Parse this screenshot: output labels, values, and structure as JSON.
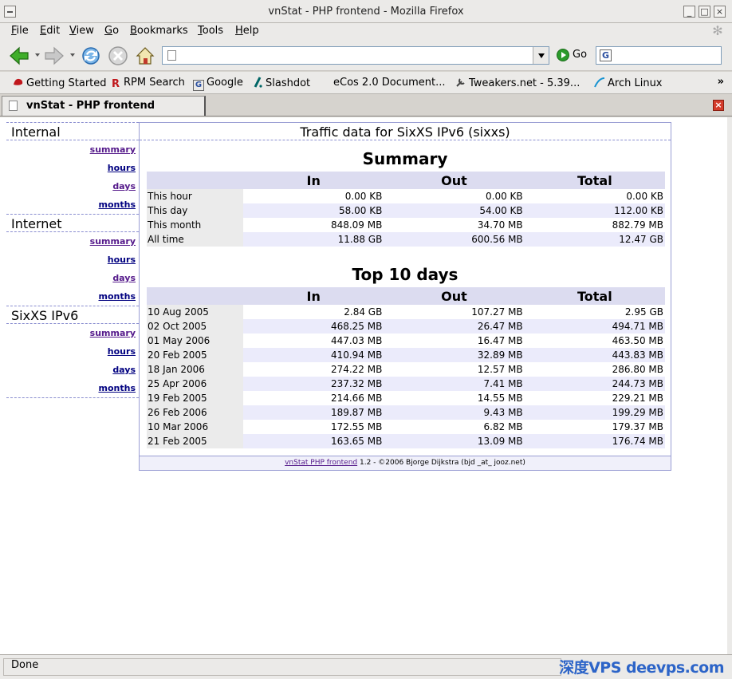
{
  "window": {
    "title": "vnStat - PHP frontend - Mozilla Firefox"
  },
  "menu": [
    "File",
    "Edit",
    "View",
    "Go",
    "Bookmarks",
    "Tools",
    "Help"
  ],
  "toolbar": {
    "go_label": "Go",
    "url_value": "",
    "search_value": ""
  },
  "bookmarks": [
    {
      "label": "Getting Started",
      "icon": "redhat-icon"
    },
    {
      "label": "RPM Search",
      "icon": "rpm-icon"
    },
    {
      "label": "Google",
      "icon": "google-icon"
    },
    {
      "label": "Slashdot",
      "icon": "slashdot-icon"
    },
    {
      "label": "eCos 2.0 Document...",
      "icon": ""
    },
    {
      "label": "Tweakers.net - 5.39...",
      "icon": "tweakers-icon"
    },
    {
      "label": "Arch Linux",
      "icon": "arch-icon"
    }
  ],
  "tab": {
    "title": "vnStat - PHP frontend"
  },
  "sidebar": [
    {
      "heading": "Internal",
      "links": [
        "summary",
        "hours",
        "days",
        "months"
      ]
    },
    {
      "heading": "Internet",
      "links": [
        "summary",
        "hours",
        "days",
        "months"
      ]
    },
    {
      "heading": "SixXS IPv6",
      "links": [
        "summary",
        "hours",
        "days",
        "months"
      ]
    }
  ],
  "main": {
    "title": "Traffic data for SixXS IPv6 (sixxs)",
    "summary": {
      "heading": "Summary",
      "columns": [
        "In",
        "Out",
        "Total"
      ],
      "rows": [
        {
          "label": "This hour",
          "in": "0.00 KB",
          "out": "0.00 KB",
          "total": "0.00 KB"
        },
        {
          "label": "This day",
          "in": "58.00 KB",
          "out": "54.00 KB",
          "total": "112.00 KB"
        },
        {
          "label": "This month",
          "in": "848.09 MB",
          "out": "34.70 MB",
          "total": "882.79 MB"
        },
        {
          "label": "All time",
          "in": "11.88 GB",
          "out": "600.56 MB",
          "total": "12.47 GB"
        }
      ]
    },
    "top10": {
      "heading": "Top 10 days",
      "columns": [
        "In",
        "Out",
        "Total"
      ],
      "rows": [
        {
          "label": "10 Aug 2005",
          "in": "2.84 GB",
          "out": "107.27 MB",
          "total": "2.95 GB"
        },
        {
          "label": "02 Oct 2005",
          "in": "468.25 MB",
          "out": "26.47 MB",
          "total": "494.71 MB"
        },
        {
          "label": "01 May 2006",
          "in": "447.03 MB",
          "out": "16.47 MB",
          "total": "463.50 MB"
        },
        {
          "label": "20 Feb 2005",
          "in": "410.94 MB",
          "out": "32.89 MB",
          "total": "443.83 MB"
        },
        {
          "label": "18 Jan 2006",
          "in": "274.22 MB",
          "out": "12.57 MB",
          "total": "286.80 MB"
        },
        {
          "label": "25 Apr 2006",
          "in": "237.32 MB",
          "out": "7.41 MB",
          "total": "244.73 MB"
        },
        {
          "label": "19 Feb 2005",
          "in": "214.66 MB",
          "out": "14.55 MB",
          "total": "229.21 MB"
        },
        {
          "label": "26 Feb 2006",
          "in": "189.87 MB",
          "out": "9.43 MB",
          "total": "199.29 MB"
        },
        {
          "label": "10 Mar 2006",
          "in": "172.55 MB",
          "out": "6.82 MB",
          "total": "179.37 MB"
        },
        {
          "label": "21 Feb 2005",
          "in": "163.65 MB",
          "out": "13.09 MB",
          "total": "176.74 MB"
        }
      ]
    },
    "footer": {
      "link": "vnStat PHP frontend",
      "text": " 1.2 - ©2006 Bjorge Dijkstra (bjd _at_ jooz.net)"
    }
  },
  "status": {
    "text": "Done",
    "watermark": "深度VPS deevps.com"
  },
  "colors": {
    "accent": "#000080",
    "visited": "#551a8b",
    "table_header": "#dcdcf0"
  }
}
